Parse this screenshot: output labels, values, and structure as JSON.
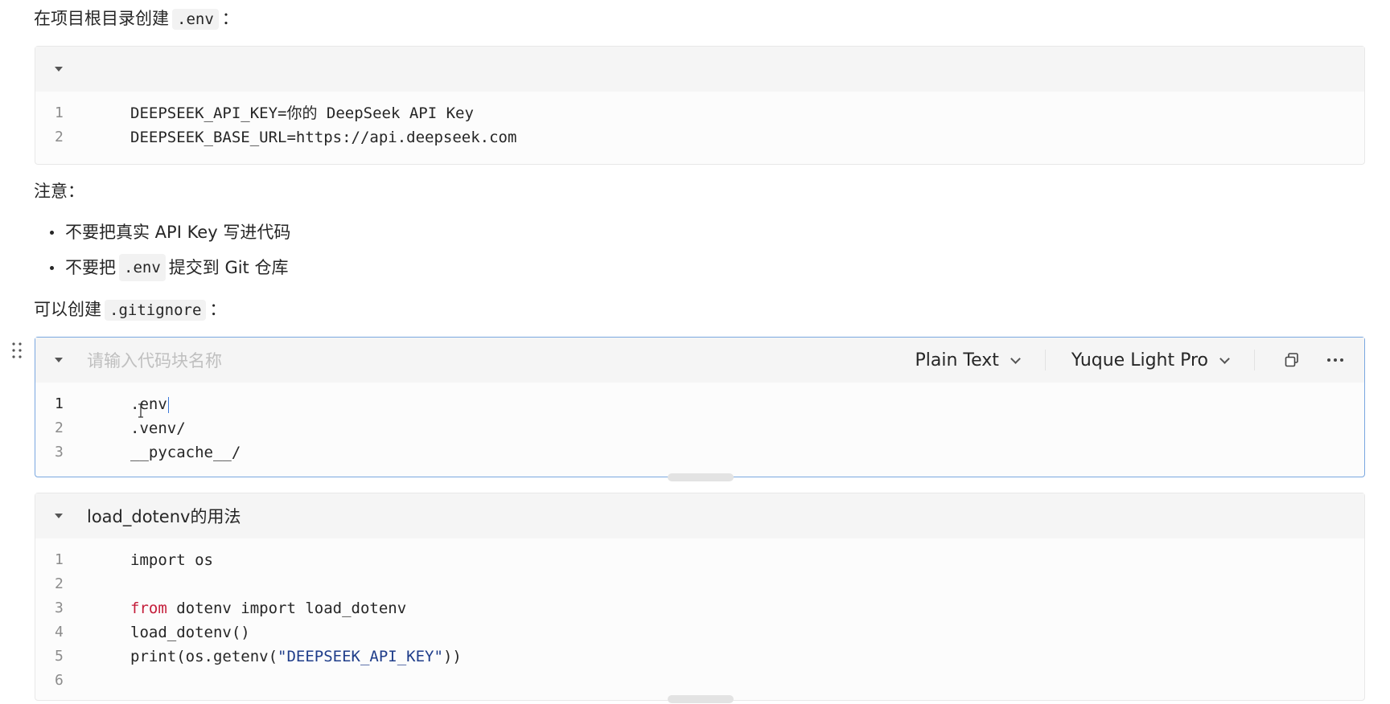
{
  "intro": {
    "text": "在项目根目录创建",
    "code": ".env",
    "colon": "："
  },
  "env_block": {
    "name": "",
    "lines": [
      {
        "n": "1",
        "text": "DEEPSEEK_API_KEY=你的 DeepSeek API Key"
      },
      {
        "n": "2",
        "text": "DEEPSEEK_BASE_URL=https://api.deepseek.com"
      }
    ]
  },
  "note": {
    "label": "注意：",
    "items": [
      {
        "text": "不要把真实 API Key 写进代码"
      },
      {
        "pre": "不要把",
        "code": ".env",
        "post": "提交到 Git 仓库"
      }
    ]
  },
  "gitignore_intro": {
    "text": "可以创建",
    "code": ".gitignore",
    "colon": "："
  },
  "gitignore_block": {
    "name_placeholder": "请输入代码块名称",
    "language": "Plain Text",
    "theme": "Yuque Light Pro",
    "copy_icon": "copy-icon",
    "more_icon": "more-icon",
    "lines": [
      {
        "n": "1",
        "text": ".env"
      },
      {
        "n": "2",
        "text": ".venv/"
      },
      {
        "n": "3",
        "text": "__pycache__/"
      }
    ]
  },
  "dotenv_block": {
    "name": "load_dotenv的用法",
    "lines": [
      {
        "n": "1",
        "text": "import os"
      },
      {
        "n": "2",
        "text": ""
      },
      {
        "n": "3",
        "kw": "from",
        "text": " dotenv import load_dotenv"
      },
      {
        "n": "4",
        "text": "load_dotenv()"
      },
      {
        "n": "5",
        "pre": "print(os.getenv(",
        "str": "\"DEEPSEEK_API_KEY\"",
        "post": "))"
      },
      {
        "n": "6",
        "text": ""
      }
    ]
  },
  "colors": {
    "keyword": "#c41d3a",
    "string": "#1f3d8a",
    "active_border": "#7aa7e0"
  }
}
